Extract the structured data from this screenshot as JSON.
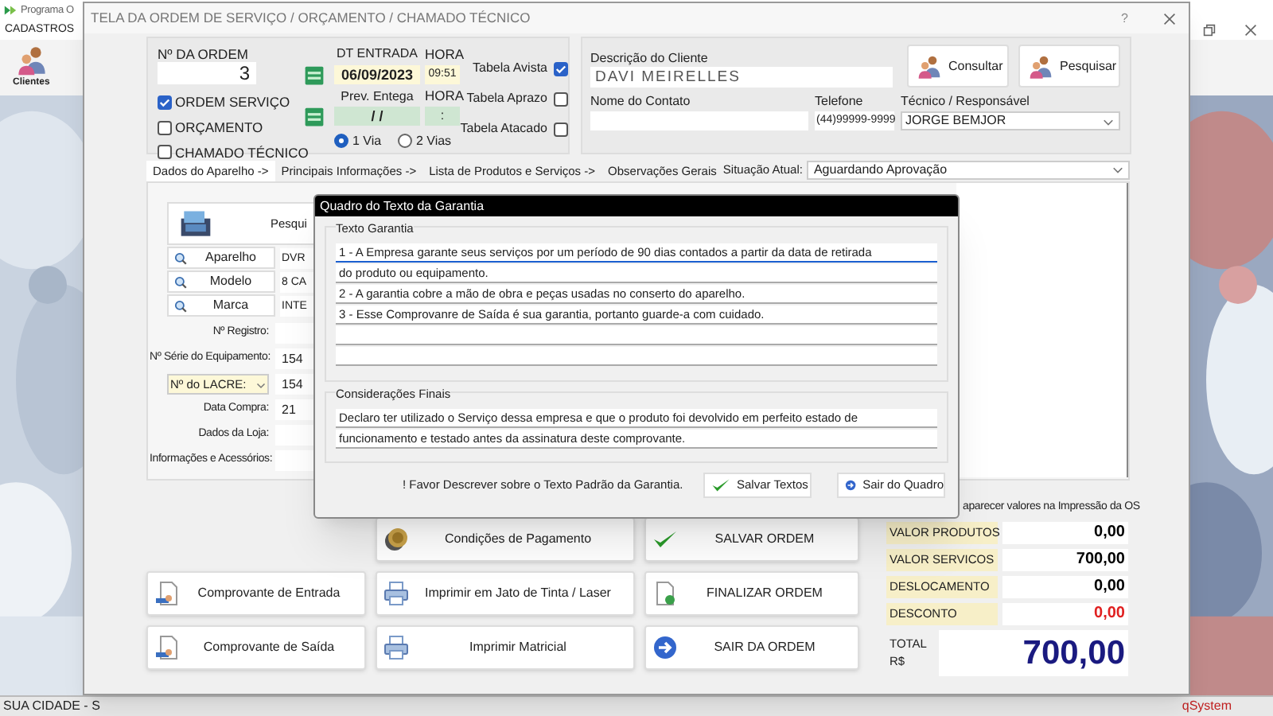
{
  "app": {
    "title": "Programa O",
    "menu": [
      {
        "label": "CADASTROS"
      }
    ],
    "toolbar": [
      {
        "label": "Clientes"
      }
    ],
    "status_bar": {
      "left": "SUA CIDADE - S",
      "right": "qSystem"
    }
  },
  "window": {
    "title": "TELA DA ORDEM DE SERVIÇO / ORÇAMENTO / CHAMADO TÉCNICO",
    "help": "?"
  },
  "order": {
    "label": "Nº DA ORDEM",
    "number": "3",
    "types": [
      {
        "label": "ORDEM SERVIÇO",
        "checked": true
      },
      {
        "label": "ORÇAMENTO",
        "checked": false
      },
      {
        "label": "CHAMADO TÉCNICO",
        "checked": false
      }
    ]
  },
  "dates": {
    "entry_label": "DT ENTRADA",
    "entry_time_label": "HORA",
    "entry_date": "06/09/2023",
    "entry_time": "09:51",
    "forecast_label": "Prev. Entega",
    "forecast_time_label": "HORA",
    "forecast_date": "/ /",
    "forecast_time": ":",
    "copies": [
      {
        "label": "1 Via",
        "selected": true
      },
      {
        "label": "2 Vias",
        "selected": false
      }
    ]
  },
  "price_tables": [
    {
      "label": "Tabela Avista",
      "checked": true
    },
    {
      "label": "Tabela Aprazo",
      "checked": false
    },
    {
      "label": "Tabela Atacado",
      "checked": false
    }
  ],
  "client": {
    "label": "Descrição do Cliente",
    "name": "DAVI MEIRELLES",
    "buttons": [
      {
        "label": "Consultar"
      },
      {
        "label": "Pesquisar"
      }
    ],
    "contact_label": "Nome do Contato",
    "phone_label": "Telefone",
    "phone": "(44)99999-9999",
    "technician_label": "Técnico / Responsável",
    "technician": "JORGE BEMJOR"
  },
  "tabs": [
    {
      "label": "Dados do Aparelho ->",
      "selected": true
    },
    {
      "label": "Principais Informações ->",
      "selected": false
    },
    {
      "label": "Lista de Produtos e Serviços ->",
      "selected": false
    },
    {
      "label": "Observações Gerais",
      "selected": false
    }
  ],
  "status": {
    "label": "Situação Atual:",
    "value": "Aguardando Aprovação"
  },
  "device": {
    "search_button": "Pesqui",
    "lookups": [
      {
        "label": "Aparelho",
        "value": "DVR"
      },
      {
        "label": "Modelo",
        "value": "8 CA"
      },
      {
        "label": "Marca",
        "value": "INTE"
      }
    ],
    "fields": [
      {
        "label": "Nº Registro:",
        "kind": "text"
      },
      {
        "label": "Nº Série do Equipamento:",
        "kind": "text",
        "value": "154"
      },
      {
        "label": "Nº do LACRE:",
        "kind": "combo",
        "value": "154"
      },
      {
        "label": "Data Compra:",
        "kind": "text",
        "value": "21"
      },
      {
        "label": "Dados da Loja:",
        "kind": "text"
      },
      {
        "label": "Informações e Acessórios:",
        "kind": "text"
      }
    ]
  },
  "print_values_note": "aparecer valores na Impressão da OS",
  "actions": [
    {
      "label": "Condições de Pagamento",
      "kind": "coin"
    },
    {
      "label": "SALVAR ORDEM",
      "kind": "check"
    },
    {
      "label": "Comprovante de Entrada",
      "kind": "receipt"
    },
    {
      "label": "Imprimir em Jato de Tinta / Laser",
      "kind": "printer"
    },
    {
      "label": "FINALIZAR ORDEM",
      "kind": "document"
    },
    {
      "label": "Comprovante de Saída",
      "kind": "receipt"
    },
    {
      "label": "Imprimir Matricial",
      "kind": "printer"
    },
    {
      "label": "SAIR DA ORDEM",
      "kind": "exit"
    }
  ],
  "totals": [
    {
      "label": "VALOR PRODUTOS",
      "value": "0,00",
      "kind": "normal"
    },
    {
      "label": "VALOR SERVICOS",
      "value": "700,00",
      "kind": "normal"
    },
    {
      "label": "DESLOCAMENTO",
      "value": "0,00",
      "kind": "normal"
    },
    {
      "label": "DESCONTO",
      "value": "0,00",
      "kind": "negative"
    }
  ],
  "total": {
    "label": "TOTAL R$",
    "value": "700,00"
  },
  "warranty_dialog": {
    "title": "Quadro do Texto da Garantia",
    "warranty_label": "Texto Garantia",
    "warranty_lines": [
      {
        "text": "1 - A Empresa garante seus serviços por um período de 90 dias contados a partir da data de retirada",
        "focused": true
      },
      {
        "text": "do produto ou equipamento.",
        "focused": false
      },
      {
        "text": "2 - A garantia cobre a mão de obra e peças usadas no conserto do aparelho.",
        "focused": false
      },
      {
        "text": "3 - Esse Comprovanre de Saída é sua garantia, portanto guarde-a com cuidado.",
        "focused": false
      },
      {
        "focused": false
      },
      {
        "focused": false
      }
    ],
    "final_label": "Considerações Finais",
    "final_lines": [
      {
        "text": "Declaro ter utilizado o Serviço dessa empresa e que o produto foi devolvido em perfeito estado de"
      },
      {
        "text": "funcionamento e testado antes da assinatura deste comprovante."
      }
    ],
    "note": "! Favor Descrever sobre o Texto Padrão da Garantia.",
    "buttons": [
      {
        "label": "Salvar Textos",
        "kind": "check"
      },
      {
        "label": "Sair do Quadro",
        "kind": "exit"
      }
    ]
  }
}
